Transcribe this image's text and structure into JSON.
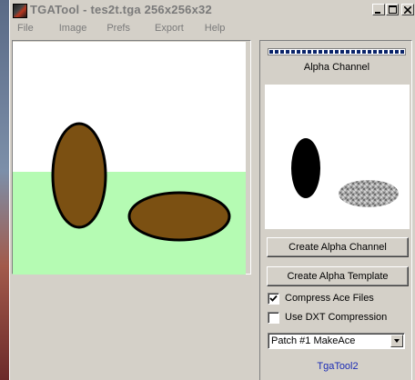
{
  "window": {
    "title": "TGATool - tes2t.tga  256x256x32",
    "controls": [
      "minimize-icon",
      "maximize-icon",
      "close-icon"
    ]
  },
  "menu": {
    "items": [
      {
        "label": "File"
      },
      {
        "label": "Image"
      },
      {
        "label": "Prefs"
      },
      {
        "label": "Export"
      },
      {
        "label": "Help"
      }
    ]
  },
  "canvas": {
    "image_size": "256x256",
    "colors": {
      "sky": "#ffffff",
      "ground": "#b5fbb3",
      "ellipse_fill": "#7b5012",
      "ellipse_stroke": "#000000"
    }
  },
  "panel": {
    "progress_fraction": 1.0,
    "alpha_label": "Alpha Channel",
    "buttons": {
      "create_alpha_channel": "Create Alpha Channel",
      "create_alpha_template": "Create Alpha Template"
    },
    "checkboxes": {
      "compress_ace": {
        "label": "Compress Ace Files",
        "checked": true
      },
      "use_dxt": {
        "label": "Use DXT Compression",
        "checked": false
      }
    },
    "select": {
      "value": "Patch #1 MakeAce"
    },
    "footer_link": "TgaTool2"
  }
}
